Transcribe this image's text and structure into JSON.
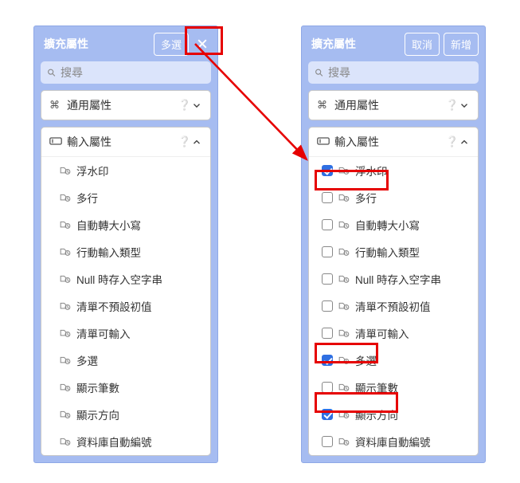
{
  "left": {
    "title": "擴充屬性",
    "multi_btn": "多選",
    "search_placeholder": "搜尋",
    "group_general": "通用屬性",
    "group_input": "輸入屬性",
    "items": [
      {
        "label": "浮水印"
      },
      {
        "label": "多行"
      },
      {
        "label": "自動轉大小寫"
      },
      {
        "label": "行動輸入類型"
      },
      {
        "label": "Null 時存入空字串"
      },
      {
        "label": "清單不預設初值"
      },
      {
        "label": "清單可輸入"
      },
      {
        "label": "多選"
      },
      {
        "label": "顯示筆數"
      },
      {
        "label": "顯示方向"
      },
      {
        "label": "資料庫自動編號"
      }
    ]
  },
  "right": {
    "title": "擴充屬性",
    "cancel_btn": "取消",
    "add_btn": "新增",
    "search_placeholder": "搜尋",
    "group_general": "通用屬性",
    "group_input": "輸入屬性",
    "items": [
      {
        "label": "浮水印",
        "checked": true
      },
      {
        "label": "多行",
        "checked": false
      },
      {
        "label": "自動轉大小寫",
        "checked": false
      },
      {
        "label": "行動輸入類型",
        "checked": false
      },
      {
        "label": "Null 時存入空字串",
        "checked": false
      },
      {
        "label": "清單不預設初值",
        "checked": false
      },
      {
        "label": "清單可輸入",
        "checked": false
      },
      {
        "label": "多選",
        "checked": true
      },
      {
        "label": "顯示筆數",
        "checked": false
      },
      {
        "label": "顯示方向",
        "checked": true
      },
      {
        "label": "資料庫自動編號",
        "checked": false
      }
    ]
  }
}
